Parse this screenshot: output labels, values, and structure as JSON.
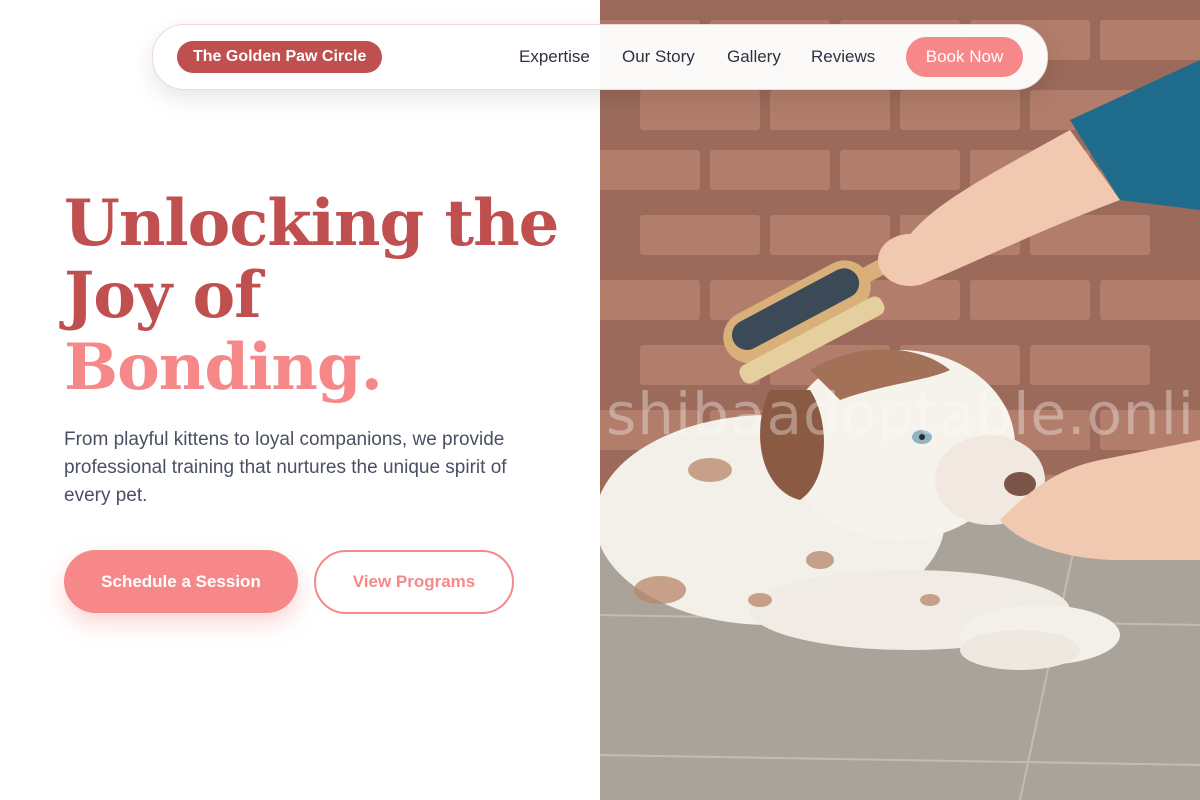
{
  "brand": {
    "name": "The Golden Paw Circle"
  },
  "nav": {
    "links": [
      "Expertise",
      "Our Story",
      "Gallery",
      "Reviews"
    ],
    "cta": "Book Now"
  },
  "hero": {
    "headline_line1": "Unlocking the",
    "headline_line2": "Joy of",
    "headline_accent": "Bonding.",
    "subtitle": "From playful kittens to loyal companions, we provide professional training that nurtures the unique spirit of every pet.",
    "primary_button": "Schedule a Session",
    "secondary_button": "View Programs"
  },
  "photo": {
    "watermark": "shibaadoptable.online"
  },
  "colors": {
    "brand_red": "#c0504f",
    "coral": "#f7888a",
    "text_dark": "#2d3142",
    "text_body": "#4a5063"
  }
}
